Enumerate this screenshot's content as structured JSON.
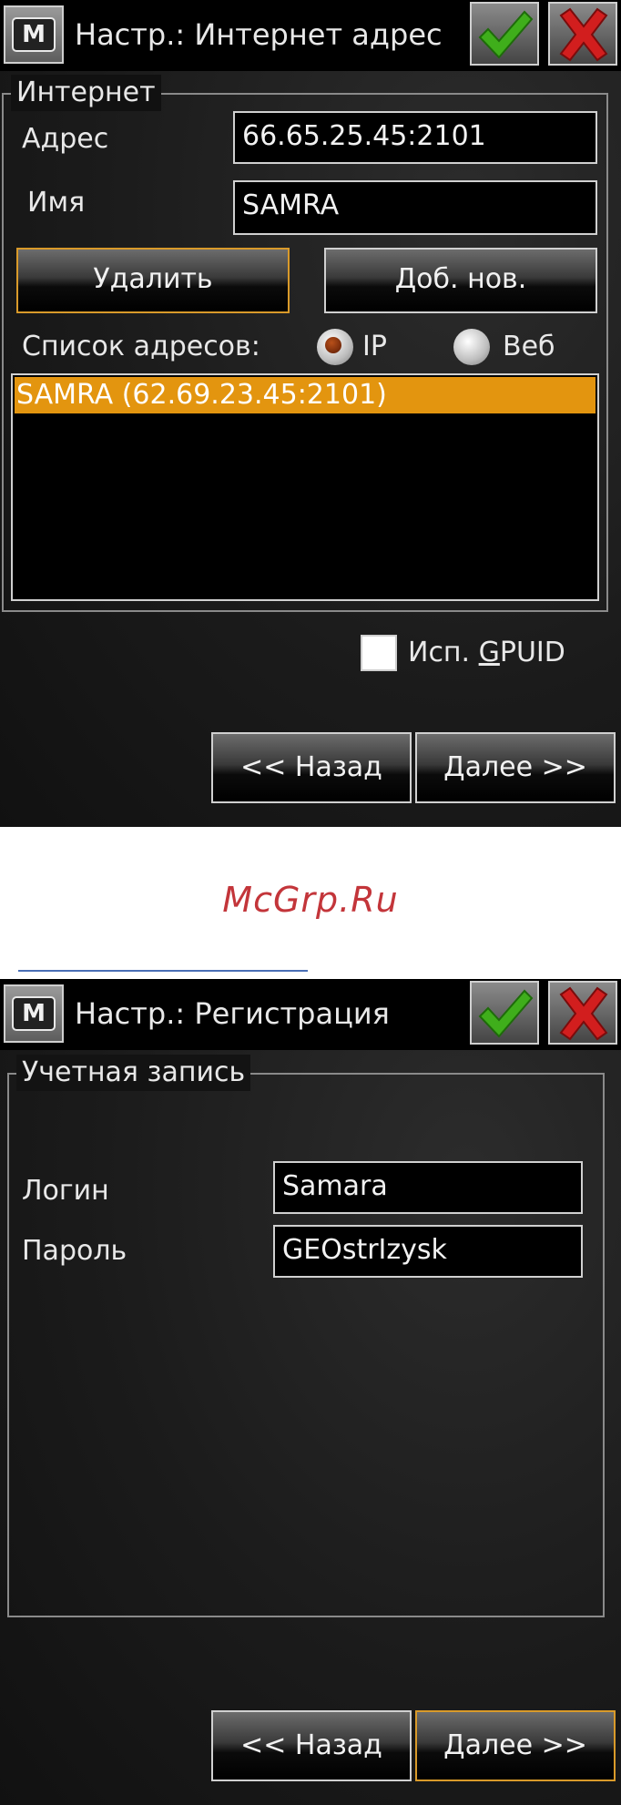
{
  "screen1": {
    "title": "Настр.: Интернет адрес",
    "menu_glyph": "M",
    "group_label": "Интернет",
    "address_label": "Адрес",
    "address_value": "66.65.25.45:2101",
    "name_label": "Имя",
    "name_value": "SAMRA",
    "delete_button": "Удалить",
    "add_button": "Доб. нов.",
    "list_label": "Список адресов:",
    "radio_ip": "IP",
    "radio_web": "Веб",
    "radio_selected": "IP",
    "list_items": [
      "SAMRA (62.69.23.45:2101)"
    ],
    "gpuid_label_prefix": "Исп. ",
    "gpuid_label_mnemonic": "G",
    "gpuid_label_suffix": "PUID",
    "gpuid_checked": false,
    "back_button": "<< Назад",
    "next_button": "Далее >>"
  },
  "watermark": "McGrp.Ru",
  "screen2": {
    "title": "Настр.: Регистрация",
    "menu_glyph": "M",
    "group_label": "Учетная запись",
    "login_label": "Логин",
    "login_value": "Samara",
    "password_label": "Пароль",
    "password_value": "GEOstrIzysk",
    "back_button": "<< Назад",
    "next_button": "Далее >>"
  },
  "colors": {
    "accent_orange": "#e3950f",
    "button_focus_border": "#d99a2a",
    "watermark_red": "#c3353a",
    "ok_green": "#3fae1b",
    "cancel_red": "#d21e1e"
  },
  "icons": {
    "menu": "menu-m-icon",
    "ok": "checkmark-icon",
    "cancel": "close-x-icon"
  }
}
